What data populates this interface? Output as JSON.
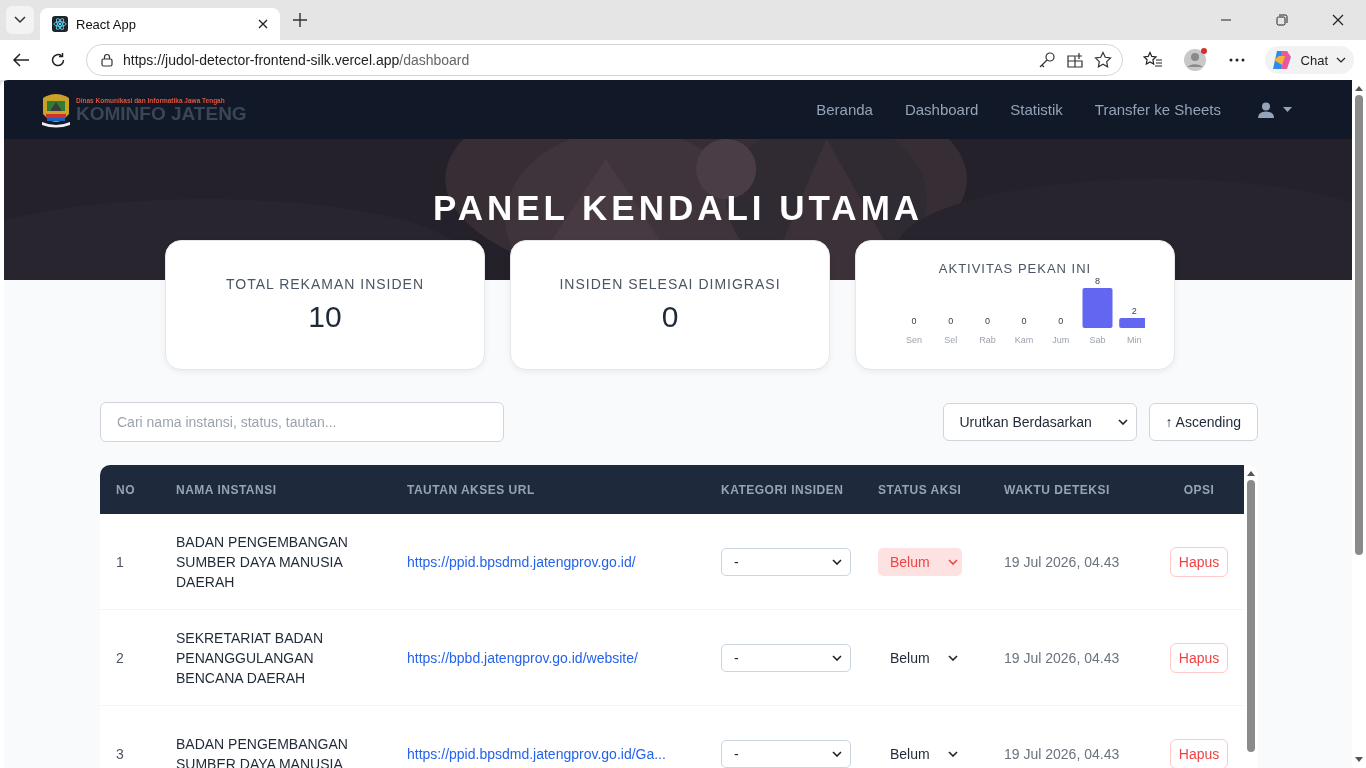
{
  "browser": {
    "tab_title": "React App",
    "url_host": "https://judol-detector-frontend-silk.vercel.app",
    "url_path": "/dashboard",
    "chat_label": "Chat"
  },
  "logo": {
    "subtitle": "Dinas Komunikasi dan Informatika Jawa Tengah",
    "title": "KOMINFO JATENG"
  },
  "nav": {
    "items": [
      {
        "label": "Beranda"
      },
      {
        "label": "Dashboard"
      },
      {
        "label": "Statistik"
      },
      {
        "label": "Transfer ke Sheets"
      }
    ]
  },
  "hero": {
    "title": "PANEL KENDALI UTAMA"
  },
  "stats": [
    {
      "label": "TOTAL REKAMAN INSIDEN",
      "value": "10"
    },
    {
      "label": "INSIDEN SELESAI DIMIGRASI",
      "value": "0"
    }
  ],
  "activity": {
    "title": "AKTIVITAS PEKAN INI",
    "chart_data": {
      "type": "bar",
      "categories": [
        "Sen",
        "Sel",
        "Rab",
        "Kam",
        "Jum",
        "Sab",
        "Min"
      ],
      "series": [
        {
          "color": "#6366f1",
          "values": [
            0,
            0,
            0,
            0,
            0,
            8,
            2
          ]
        }
      ],
      "data_labels": true
    }
  },
  "search": {
    "placeholder": "Cari nama instansi, status, tautan..."
  },
  "sort": {
    "value": "Urutkan Berdasarkan",
    "order_button": "↑ Ascending"
  },
  "table": {
    "columns": [
      "NO",
      "NAMA INSTANSI",
      "TAUTAN AKSES URL",
      "KATEGORI INSIDEN",
      "STATUS AKSI",
      "WAKTU DETEKSI",
      "OPSI"
    ],
    "rows": [
      {
        "no": "1",
        "name": "BADAN PENGEMBANGAN SUMBER DAYA MANUSIA DAERAH",
        "url": "https://ppid.bpsdmd.jatengprov.go.id/",
        "category": "-",
        "status": "Belum",
        "highlighted": true,
        "time": "19 Jul 2026, 04.43",
        "action": "Hapus"
      },
      {
        "no": "2",
        "name": "SEKRETARIAT BADAN PENANGGULANGAN BENCANA DAERAH",
        "url": "https://bpbd.jatengprov.go.id/website/",
        "category": "-",
        "status": "Belum",
        "highlighted": false,
        "time": "19 Jul 2026, 04.43",
        "action": "Hapus"
      },
      {
        "no": "3",
        "name": "BADAN PENGEMBANGAN SUMBER DAYA MANUSIA",
        "url": "https://ppid.bpsdmd.jatengprov.go.id/Ga...",
        "category": "-",
        "status": "Belum",
        "highlighted": false,
        "time": "19 Jul 2026, 04.43",
        "action": "Hapus"
      }
    ]
  }
}
